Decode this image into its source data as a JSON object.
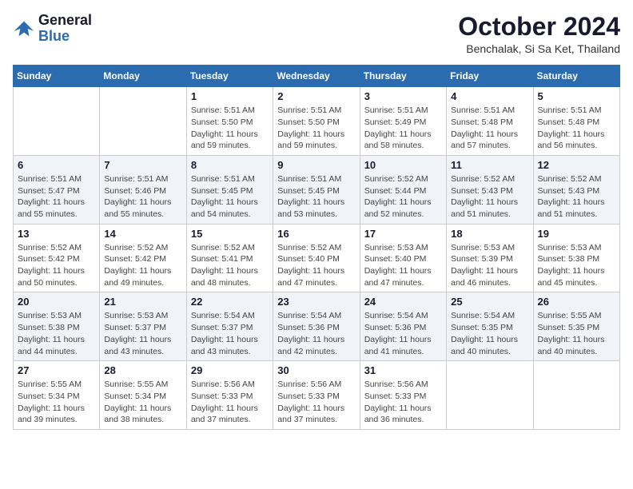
{
  "header": {
    "logo_line1": "General",
    "logo_line2": "Blue",
    "month_title": "October 2024",
    "location": "Benchalak, Si Sa Ket, Thailand"
  },
  "days_of_week": [
    "Sunday",
    "Monday",
    "Tuesday",
    "Wednesday",
    "Thursday",
    "Friday",
    "Saturday"
  ],
  "weeks": [
    [
      {
        "day": "",
        "sunrise": "",
        "sunset": "",
        "daylight": ""
      },
      {
        "day": "",
        "sunrise": "",
        "sunset": "",
        "daylight": ""
      },
      {
        "day": "1",
        "sunrise": "Sunrise: 5:51 AM",
        "sunset": "Sunset: 5:50 PM",
        "daylight": "Daylight: 11 hours and 59 minutes."
      },
      {
        "day": "2",
        "sunrise": "Sunrise: 5:51 AM",
        "sunset": "Sunset: 5:50 PM",
        "daylight": "Daylight: 11 hours and 59 minutes."
      },
      {
        "day": "3",
        "sunrise": "Sunrise: 5:51 AM",
        "sunset": "Sunset: 5:49 PM",
        "daylight": "Daylight: 11 hours and 58 minutes."
      },
      {
        "day": "4",
        "sunrise": "Sunrise: 5:51 AM",
        "sunset": "Sunset: 5:48 PM",
        "daylight": "Daylight: 11 hours and 57 minutes."
      },
      {
        "day": "5",
        "sunrise": "Sunrise: 5:51 AM",
        "sunset": "Sunset: 5:48 PM",
        "daylight": "Daylight: 11 hours and 56 minutes."
      }
    ],
    [
      {
        "day": "6",
        "sunrise": "Sunrise: 5:51 AM",
        "sunset": "Sunset: 5:47 PM",
        "daylight": "Daylight: 11 hours and 55 minutes."
      },
      {
        "day": "7",
        "sunrise": "Sunrise: 5:51 AM",
        "sunset": "Sunset: 5:46 PM",
        "daylight": "Daylight: 11 hours and 55 minutes."
      },
      {
        "day": "8",
        "sunrise": "Sunrise: 5:51 AM",
        "sunset": "Sunset: 5:45 PM",
        "daylight": "Daylight: 11 hours and 54 minutes."
      },
      {
        "day": "9",
        "sunrise": "Sunrise: 5:51 AM",
        "sunset": "Sunset: 5:45 PM",
        "daylight": "Daylight: 11 hours and 53 minutes."
      },
      {
        "day": "10",
        "sunrise": "Sunrise: 5:52 AM",
        "sunset": "Sunset: 5:44 PM",
        "daylight": "Daylight: 11 hours and 52 minutes."
      },
      {
        "day": "11",
        "sunrise": "Sunrise: 5:52 AM",
        "sunset": "Sunset: 5:43 PM",
        "daylight": "Daylight: 11 hours and 51 minutes."
      },
      {
        "day": "12",
        "sunrise": "Sunrise: 5:52 AM",
        "sunset": "Sunset: 5:43 PM",
        "daylight": "Daylight: 11 hours and 51 minutes."
      }
    ],
    [
      {
        "day": "13",
        "sunrise": "Sunrise: 5:52 AM",
        "sunset": "Sunset: 5:42 PM",
        "daylight": "Daylight: 11 hours and 50 minutes."
      },
      {
        "day": "14",
        "sunrise": "Sunrise: 5:52 AM",
        "sunset": "Sunset: 5:42 PM",
        "daylight": "Daylight: 11 hours and 49 minutes."
      },
      {
        "day": "15",
        "sunrise": "Sunrise: 5:52 AM",
        "sunset": "Sunset: 5:41 PM",
        "daylight": "Daylight: 11 hours and 48 minutes."
      },
      {
        "day": "16",
        "sunrise": "Sunrise: 5:52 AM",
        "sunset": "Sunset: 5:40 PM",
        "daylight": "Daylight: 11 hours and 47 minutes."
      },
      {
        "day": "17",
        "sunrise": "Sunrise: 5:53 AM",
        "sunset": "Sunset: 5:40 PM",
        "daylight": "Daylight: 11 hours and 47 minutes."
      },
      {
        "day": "18",
        "sunrise": "Sunrise: 5:53 AM",
        "sunset": "Sunset: 5:39 PM",
        "daylight": "Daylight: 11 hours and 46 minutes."
      },
      {
        "day": "19",
        "sunrise": "Sunrise: 5:53 AM",
        "sunset": "Sunset: 5:38 PM",
        "daylight": "Daylight: 11 hours and 45 minutes."
      }
    ],
    [
      {
        "day": "20",
        "sunrise": "Sunrise: 5:53 AM",
        "sunset": "Sunset: 5:38 PM",
        "daylight": "Daylight: 11 hours and 44 minutes."
      },
      {
        "day": "21",
        "sunrise": "Sunrise: 5:53 AM",
        "sunset": "Sunset: 5:37 PM",
        "daylight": "Daylight: 11 hours and 43 minutes."
      },
      {
        "day": "22",
        "sunrise": "Sunrise: 5:54 AM",
        "sunset": "Sunset: 5:37 PM",
        "daylight": "Daylight: 11 hours and 43 minutes."
      },
      {
        "day": "23",
        "sunrise": "Sunrise: 5:54 AM",
        "sunset": "Sunset: 5:36 PM",
        "daylight": "Daylight: 11 hours and 42 minutes."
      },
      {
        "day": "24",
        "sunrise": "Sunrise: 5:54 AM",
        "sunset": "Sunset: 5:36 PM",
        "daylight": "Daylight: 11 hours and 41 minutes."
      },
      {
        "day": "25",
        "sunrise": "Sunrise: 5:54 AM",
        "sunset": "Sunset: 5:35 PM",
        "daylight": "Daylight: 11 hours and 40 minutes."
      },
      {
        "day": "26",
        "sunrise": "Sunrise: 5:55 AM",
        "sunset": "Sunset: 5:35 PM",
        "daylight": "Daylight: 11 hours and 40 minutes."
      }
    ],
    [
      {
        "day": "27",
        "sunrise": "Sunrise: 5:55 AM",
        "sunset": "Sunset: 5:34 PM",
        "daylight": "Daylight: 11 hours and 39 minutes."
      },
      {
        "day": "28",
        "sunrise": "Sunrise: 5:55 AM",
        "sunset": "Sunset: 5:34 PM",
        "daylight": "Daylight: 11 hours and 38 minutes."
      },
      {
        "day": "29",
        "sunrise": "Sunrise: 5:56 AM",
        "sunset": "Sunset: 5:33 PM",
        "daylight": "Daylight: 11 hours and 37 minutes."
      },
      {
        "day": "30",
        "sunrise": "Sunrise: 5:56 AM",
        "sunset": "Sunset: 5:33 PM",
        "daylight": "Daylight: 11 hours and 37 minutes."
      },
      {
        "day": "31",
        "sunrise": "Sunrise: 5:56 AM",
        "sunset": "Sunset: 5:33 PM",
        "daylight": "Daylight: 11 hours and 36 minutes."
      },
      {
        "day": "",
        "sunrise": "",
        "sunset": "",
        "daylight": ""
      },
      {
        "day": "",
        "sunrise": "",
        "sunset": "",
        "daylight": ""
      }
    ]
  ]
}
